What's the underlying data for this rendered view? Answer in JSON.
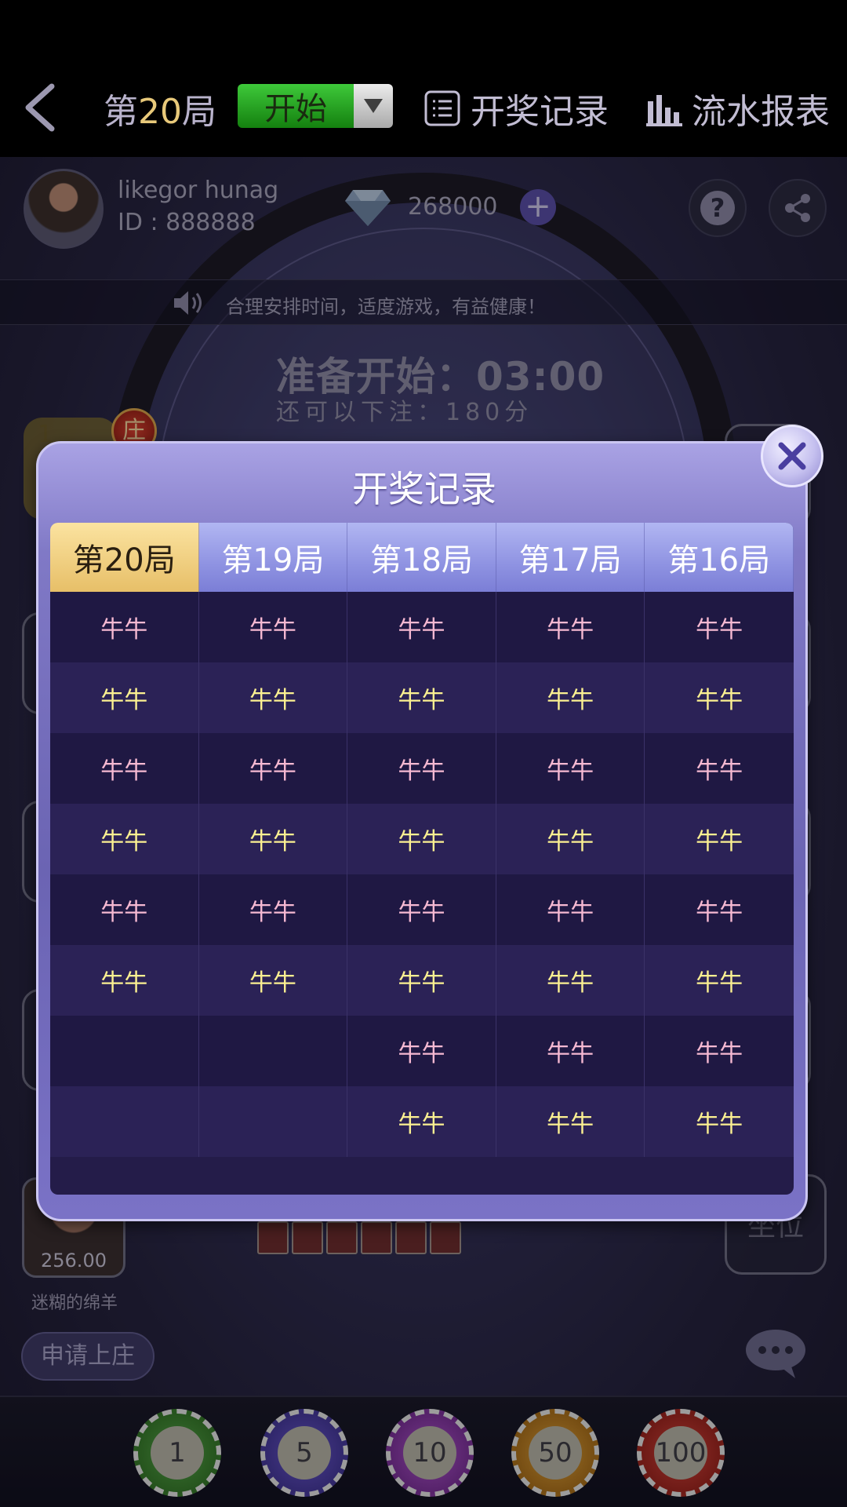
{
  "topbar": {
    "round_prefix": "第",
    "round_number": "20",
    "round_suffix": "局",
    "start_label": "开始",
    "record_label": "开奖记录",
    "flow_label": "流水报表"
  },
  "profile": {
    "name": "likegor hunag",
    "id_text": "ID : 888888",
    "diamonds": "268000"
  },
  "notice": "合理安排时间，适度游戏，有益健康！",
  "game": {
    "ready_text": "准备开始：03:00",
    "bet_text": "还可以下注：180分",
    "banker_badge": "庄",
    "seat_number": "1",
    "bottom_player_score": "256.00",
    "bottom_player_name": "迷糊的绵羊",
    "apply_banker": "申请上庄",
    "sit_label": "坐位"
  },
  "chips": [
    "1",
    "5",
    "10",
    "50",
    "100"
  ],
  "modal": {
    "title": "开奖记录",
    "tabs": [
      "第20局",
      "第19局",
      "第18局",
      "第17局",
      "第16局"
    ],
    "active_tab": 0,
    "rows": [
      [
        "牛牛",
        "牛牛",
        "牛牛",
        "牛牛",
        "牛牛"
      ],
      [
        "牛牛",
        "牛牛",
        "牛牛",
        "牛牛",
        "牛牛"
      ],
      [
        "牛牛",
        "牛牛",
        "牛牛",
        "牛牛",
        "牛牛"
      ],
      [
        "牛牛",
        "牛牛",
        "牛牛",
        "牛牛",
        "牛牛"
      ],
      [
        "牛牛",
        "牛牛",
        "牛牛",
        "牛牛",
        "牛牛"
      ],
      [
        "牛牛",
        "牛牛",
        "牛牛",
        "牛牛",
        "牛牛"
      ],
      [
        "",
        "",
        "牛牛",
        "牛牛",
        "牛牛"
      ],
      [
        "",
        "",
        "牛牛",
        "牛牛",
        "牛牛"
      ]
    ]
  },
  "colors": {
    "pink_text": "#f6b9d2",
    "yellow_text": "#fbf091",
    "active_tab": "#e7bf68"
  }
}
